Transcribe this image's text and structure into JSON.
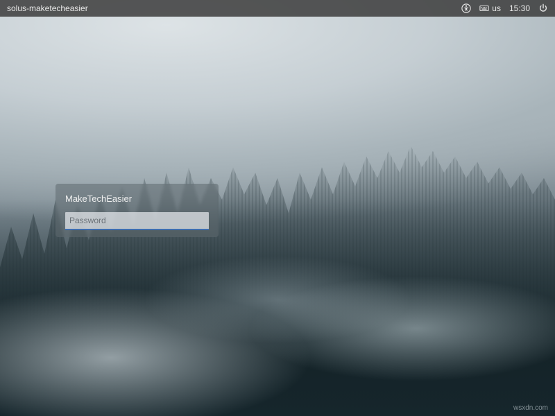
{
  "topbar": {
    "hostname": "solus-maketecheasier",
    "keyboard_layout": "us",
    "clock": "15:30"
  },
  "login": {
    "username": "MakeTechEasier",
    "password_placeholder": "Password",
    "password_value": ""
  },
  "colors": {
    "accent": "#3d6db0",
    "panel": "rgba(60,60,60,0.85)"
  },
  "watermark": "wsxdn.com"
}
